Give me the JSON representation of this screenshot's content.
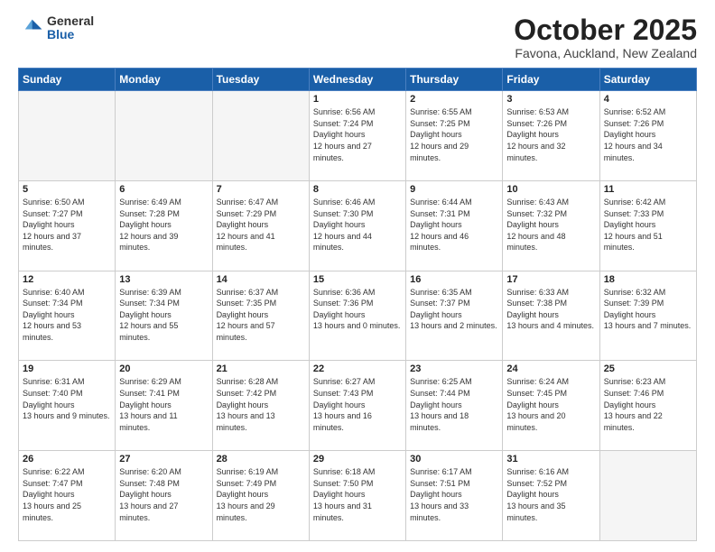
{
  "logo": {
    "general": "General",
    "blue": "Blue"
  },
  "header": {
    "month": "October 2025",
    "location": "Favona, Auckland, New Zealand"
  },
  "weekdays": [
    "Sunday",
    "Monday",
    "Tuesday",
    "Wednesday",
    "Thursday",
    "Friday",
    "Saturday"
  ],
  "weeks": [
    [
      {
        "day": "",
        "empty": true
      },
      {
        "day": "",
        "empty": true
      },
      {
        "day": "",
        "empty": true
      },
      {
        "day": "1",
        "sunrise": "6:56 AM",
        "sunset": "7:24 PM",
        "daylight": "12 hours and 27 minutes."
      },
      {
        "day": "2",
        "sunrise": "6:55 AM",
        "sunset": "7:25 PM",
        "daylight": "12 hours and 29 minutes."
      },
      {
        "day": "3",
        "sunrise": "6:53 AM",
        "sunset": "7:26 PM",
        "daylight": "12 hours and 32 minutes."
      },
      {
        "day": "4",
        "sunrise": "6:52 AM",
        "sunset": "7:26 PM",
        "daylight": "12 hours and 34 minutes."
      }
    ],
    [
      {
        "day": "5",
        "sunrise": "6:50 AM",
        "sunset": "7:27 PM",
        "daylight": "12 hours and 37 minutes."
      },
      {
        "day": "6",
        "sunrise": "6:49 AM",
        "sunset": "7:28 PM",
        "daylight": "12 hours and 39 minutes."
      },
      {
        "day": "7",
        "sunrise": "6:47 AM",
        "sunset": "7:29 PM",
        "daylight": "12 hours and 41 minutes."
      },
      {
        "day": "8",
        "sunrise": "6:46 AM",
        "sunset": "7:30 PM",
        "daylight": "12 hours and 44 minutes."
      },
      {
        "day": "9",
        "sunrise": "6:44 AM",
        "sunset": "7:31 PM",
        "daylight": "12 hours and 46 minutes."
      },
      {
        "day": "10",
        "sunrise": "6:43 AM",
        "sunset": "7:32 PM",
        "daylight": "12 hours and 48 minutes."
      },
      {
        "day": "11",
        "sunrise": "6:42 AM",
        "sunset": "7:33 PM",
        "daylight": "12 hours and 51 minutes."
      }
    ],
    [
      {
        "day": "12",
        "sunrise": "6:40 AM",
        "sunset": "7:34 PM",
        "daylight": "12 hours and 53 minutes."
      },
      {
        "day": "13",
        "sunrise": "6:39 AM",
        "sunset": "7:34 PM",
        "daylight": "12 hours and 55 minutes."
      },
      {
        "day": "14",
        "sunrise": "6:37 AM",
        "sunset": "7:35 PM",
        "daylight": "12 hours and 57 minutes."
      },
      {
        "day": "15",
        "sunrise": "6:36 AM",
        "sunset": "7:36 PM",
        "daylight": "13 hours and 0 minutes."
      },
      {
        "day": "16",
        "sunrise": "6:35 AM",
        "sunset": "7:37 PM",
        "daylight": "13 hours and 2 minutes."
      },
      {
        "day": "17",
        "sunrise": "6:33 AM",
        "sunset": "7:38 PM",
        "daylight": "13 hours and 4 minutes."
      },
      {
        "day": "18",
        "sunrise": "6:32 AM",
        "sunset": "7:39 PM",
        "daylight": "13 hours and 7 minutes."
      }
    ],
    [
      {
        "day": "19",
        "sunrise": "6:31 AM",
        "sunset": "7:40 PM",
        "daylight": "13 hours and 9 minutes."
      },
      {
        "day": "20",
        "sunrise": "6:29 AM",
        "sunset": "7:41 PM",
        "daylight": "13 hours and 11 minutes."
      },
      {
        "day": "21",
        "sunrise": "6:28 AM",
        "sunset": "7:42 PM",
        "daylight": "13 hours and 13 minutes."
      },
      {
        "day": "22",
        "sunrise": "6:27 AM",
        "sunset": "7:43 PM",
        "daylight": "13 hours and 16 minutes."
      },
      {
        "day": "23",
        "sunrise": "6:25 AM",
        "sunset": "7:44 PM",
        "daylight": "13 hours and 18 minutes."
      },
      {
        "day": "24",
        "sunrise": "6:24 AM",
        "sunset": "7:45 PM",
        "daylight": "13 hours and 20 minutes."
      },
      {
        "day": "25",
        "sunrise": "6:23 AM",
        "sunset": "7:46 PM",
        "daylight": "13 hours and 22 minutes."
      }
    ],
    [
      {
        "day": "26",
        "sunrise": "6:22 AM",
        "sunset": "7:47 PM",
        "daylight": "13 hours and 25 minutes."
      },
      {
        "day": "27",
        "sunrise": "6:20 AM",
        "sunset": "7:48 PM",
        "daylight": "13 hours and 27 minutes."
      },
      {
        "day": "28",
        "sunrise": "6:19 AM",
        "sunset": "7:49 PM",
        "daylight": "13 hours and 29 minutes."
      },
      {
        "day": "29",
        "sunrise": "6:18 AM",
        "sunset": "7:50 PM",
        "daylight": "13 hours and 31 minutes."
      },
      {
        "day": "30",
        "sunrise": "6:17 AM",
        "sunset": "7:51 PM",
        "daylight": "13 hours and 33 minutes."
      },
      {
        "day": "31",
        "sunrise": "6:16 AM",
        "sunset": "7:52 PM",
        "daylight": "13 hours and 35 minutes."
      },
      {
        "day": "",
        "empty": true
      }
    ]
  ]
}
